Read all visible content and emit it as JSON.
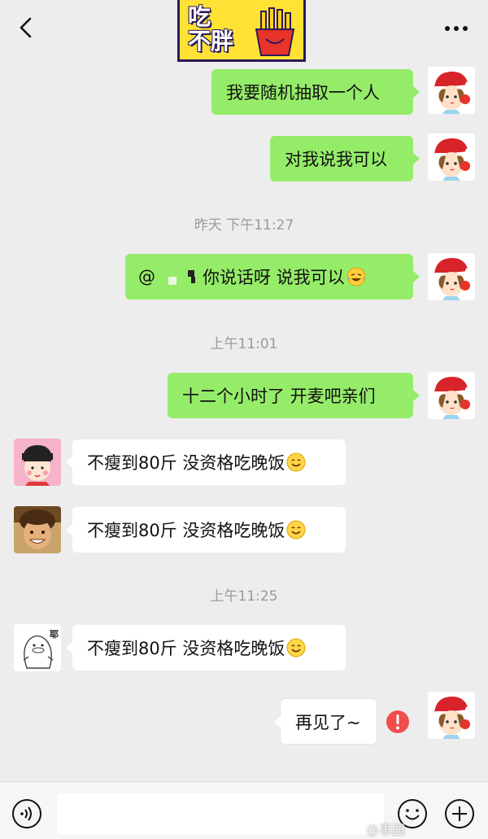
{
  "header": {
    "back_icon": "chevron-left-icon",
    "more_icon": "ellipsis-icon",
    "logo_line1": "吃",
    "logo_line2": "不胖"
  },
  "messages": [
    {
      "side": "out",
      "text": "我要随机抽取一个人"
    },
    {
      "side": "out",
      "text": "对我说我可以"
    },
    {
      "type": "time",
      "text": "昨天 下午11:27"
    },
    {
      "side": "out",
      "prefix": "@",
      "text": "你说话呀 说我可以",
      "emoji": "laughing-crying-emoji"
    },
    {
      "type": "time",
      "text": "上午11:01"
    },
    {
      "side": "out",
      "text": "十二个小时了 开麦吧亲们"
    },
    {
      "side": "in",
      "text": "不瘦到80斤 没资格吃晚饭",
      "emoji": "smiling-emoji"
    },
    {
      "side": "in",
      "text": "不瘦到80斤 没资格吃晚饭",
      "emoji": "smiling-emoji"
    },
    {
      "type": "time",
      "text": "上午11:25"
    },
    {
      "side": "in",
      "text": "不瘦到80斤 没资格吃晚饭",
      "emoji": "smiling-emoji"
    },
    {
      "side": "out",
      "text": "再见了~",
      "failed": true
    }
  ],
  "avatars": {
    "me": "christmas-hat-girl-avatar",
    "friend1": "cartoon-girl-avatar",
    "friend2": "child-photo-avatar",
    "friend3": "duck-sketch-avatar",
    "friend3_tag": "耶"
  },
  "colors": {
    "outgoing_bubble": "#95ec69",
    "incoming_bubble": "#ffffff",
    "background": "#ededed",
    "error": "#f04d4d"
  },
  "bottom": {
    "voice_icon": "voice-icon",
    "emoji_icon": "emoji-face-icon",
    "plus_icon": "plus-circle-icon"
  },
  "watermark": "@事园"
}
